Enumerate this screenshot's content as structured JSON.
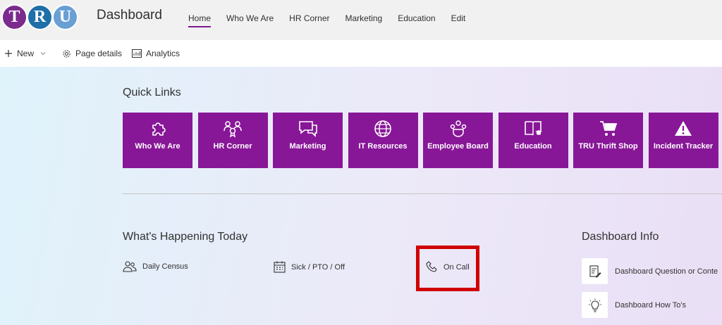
{
  "header": {
    "logo_letters": [
      "T",
      "R",
      "U"
    ],
    "logo_colors": [
      "#7b2a8e",
      "#1f6fa8",
      "#6a9fd4"
    ],
    "site_title": "Dashboard",
    "nav": [
      "Home",
      "Who We Are",
      "HR Corner",
      "Marketing",
      "Education",
      "Edit"
    ]
  },
  "commandbar": {
    "new_label": "New",
    "page_details_label": "Page details",
    "analytics_label": "Analytics"
  },
  "quick_links": {
    "title": "Quick Links",
    "tile_color": "#881798",
    "tiles": [
      {
        "label": "Who We Are",
        "icon": "puzzle-icon"
      },
      {
        "label": "HR Corner",
        "icon": "people-award-icon"
      },
      {
        "label": "Marketing",
        "icon": "chat-bubbles-icon"
      },
      {
        "label": "IT Resources",
        "icon": "globe-icon"
      },
      {
        "label": "Employee Board",
        "icon": "team-icon"
      },
      {
        "label": "Education",
        "icon": "book-cap-icon"
      },
      {
        "label": "TRU Thrift Shop",
        "icon": "cart-icon"
      },
      {
        "label": "Incident Tracker",
        "icon": "warning-icon"
      }
    ]
  },
  "happening": {
    "title": "What's Happening Today",
    "items": [
      {
        "label": "Daily Census",
        "icon": "people-icon"
      },
      {
        "label": "Sick / PTO / Off",
        "icon": "calendar-icon"
      },
      {
        "label": "On Call",
        "icon": "phone-icon"
      }
    ],
    "highlight_color": "#d00000"
  },
  "dashboard_info": {
    "title": "Dashboard Info",
    "items": [
      {
        "label": "Dashboard Question or Conte",
        "icon": "edit-form-icon"
      },
      {
        "label": "Dashboard How To's",
        "icon": "lightbulb-icon"
      }
    ]
  }
}
